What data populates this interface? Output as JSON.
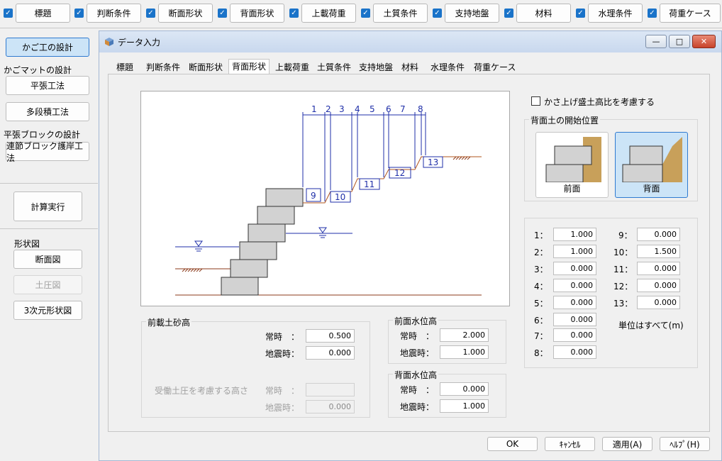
{
  "toolbar": {
    "items": [
      {
        "label": "標題"
      },
      {
        "label": "判断条件"
      },
      {
        "label": "断面形状"
      },
      {
        "label": "背面形状"
      },
      {
        "label": "上載荷重"
      },
      {
        "label": "土質条件"
      },
      {
        "label": "支持地盤"
      },
      {
        "label": "材料"
      },
      {
        "label": "水理条件"
      },
      {
        "label": "荷重ケース"
      }
    ]
  },
  "sidebar": {
    "kago_design": "かご工の設計",
    "mat_heading": "かごマットの設計",
    "flat": "平張工法",
    "multi": "多段積工法",
    "block_heading": "平張ブロックの設計",
    "block_btn": "連節ブロック護岸工法",
    "calc": "計算実行",
    "shape_heading": "形状図",
    "section_fig": "断面図",
    "earth_pressure": "土圧図",
    "three_d": "3次元形状図"
  },
  "dialog": {
    "title": "データ入力",
    "minimize": "—",
    "maximize": "□",
    "close": "✕",
    "tabs": [
      "標題",
      "判断条件",
      "断面形状",
      "背面形状",
      "上載荷重",
      "土質条件",
      "支持地盤",
      "材料",
      "水理条件",
      "荷重ケース"
    ],
    "active_tab": "背面形状",
    "buttons": {
      "ok": "OK",
      "cancel": "ｷｬﾝｾﾙ",
      "apply": "適用(A)",
      "help": "ﾍﾙﾌﾟ(H)"
    }
  },
  "figure": {
    "top_dims": [
      "1",
      "2",
      "3",
      "4",
      "5",
      "6",
      "7",
      "8"
    ],
    "step_labels": [
      "9",
      "10",
      "11",
      "12",
      "13"
    ]
  },
  "fill": {
    "title": "前載土砂高",
    "normal_label": "常時　：",
    "normal_value": "0.500",
    "quake_label": "地震時：",
    "quake_value": "0.000",
    "passive_label": "受働土圧を考慮する高さ",
    "passive_normal_label": "常時　：",
    "passive_normal_value": "",
    "passive_quake_label": "地震時：",
    "passive_quake_value": "0.000"
  },
  "front_water": {
    "title": "前面水位高",
    "normal_label": "常時　：",
    "normal_value": "2.000",
    "quake_label": "地震時：",
    "quake_value": "1.000"
  },
  "back_water": {
    "title": "背面水位高",
    "normal_label": "常時　：",
    "normal_value": "0.000",
    "quake_label": "地震時：",
    "quake_value": "1.000"
  },
  "options": {
    "raise_ratio_label": "かさ上げ盛土高比を考慮する",
    "raise_ratio_checked": false,
    "start_pos_title": "背面土の開始位置",
    "front_label": "前面",
    "back_label": "背面",
    "selected": "背面",
    "soil_color": "#c8a05a",
    "block_color": "#d2d2d2"
  },
  "dims": {
    "left": [
      {
        "label": "1：",
        "value": "1.000"
      },
      {
        "label": "2：",
        "value": "1.000"
      },
      {
        "label": "3：",
        "value": "0.000"
      },
      {
        "label": "4：",
        "value": "0.000"
      },
      {
        "label": "5：",
        "value": "0.000"
      },
      {
        "label": "6：",
        "value": "0.000"
      },
      {
        "label": "7：",
        "value": "0.000"
      },
      {
        "label": "8：",
        "value": "0.000"
      }
    ],
    "right": [
      {
        "label": "9：",
        "value": "0.000"
      },
      {
        "label": "10：",
        "value": "1.500"
      },
      {
        "label": "11：",
        "value": "0.000"
      },
      {
        "label": "12：",
        "value": "0.000"
      },
      {
        "label": "13：",
        "value": "0.000"
      }
    ],
    "unit_note": "単位はすべて(m)"
  }
}
